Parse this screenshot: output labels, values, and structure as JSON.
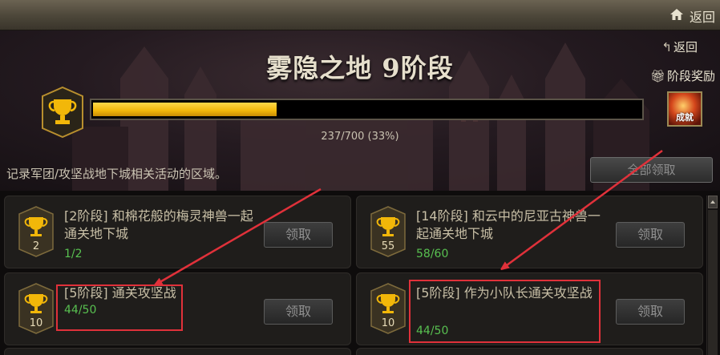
{
  "topbar": {
    "home_icon": "home-icon",
    "back_label": "返回"
  },
  "banner": {
    "title": "雾隐之地 9阶段",
    "back_label": "返回",
    "reward_label": "阶段奖励",
    "progress": {
      "current": 237,
      "total": 700,
      "percent": 33,
      "text": "237/700 (33%)"
    },
    "achievement_label": "成就"
  },
  "description": "记录军团/攻坚战地下城相关活动的区域。",
  "claim_all_label": "全部领取",
  "colors": {
    "progress_fill": "#f2b709",
    "progress_text_green": "#58c050",
    "annotation_red": "#e0313a"
  },
  "quests": [
    {
      "level": "2",
      "title": "[2阶段] 和棉花般的梅灵神兽一起通关地下城",
      "progress": "1/2",
      "button": "领取"
    },
    {
      "level": "55",
      "title": "[14阶段] 和云中的尼亚古神兽一起通关地下城",
      "progress": "58/60",
      "button": "领取"
    },
    {
      "level": "10",
      "title": "[5阶段] 通关攻坚战",
      "progress": "44/50",
      "button": "领取"
    },
    {
      "level": "10",
      "title": "[5阶段] 作为小队长通关攻坚战",
      "progress": "44/50",
      "button": "领取"
    }
  ]
}
